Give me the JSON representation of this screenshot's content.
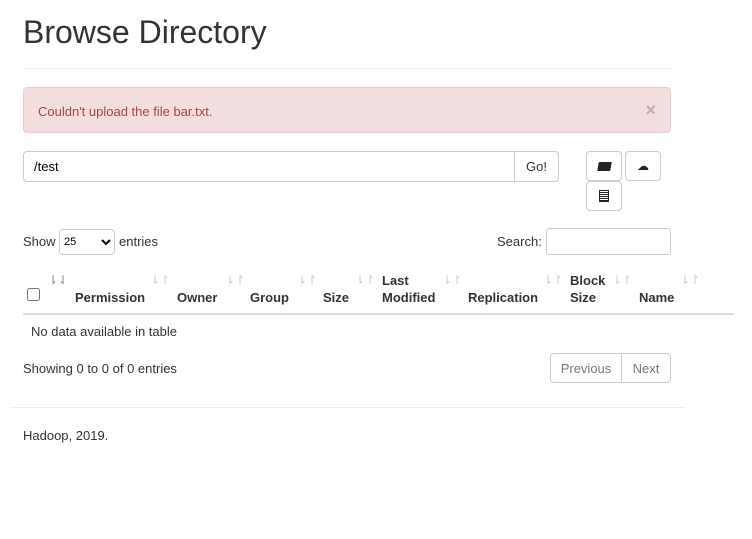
{
  "title": "Browse Directory",
  "alert": {
    "message": "Couldn't upload the file bar.txt.",
    "close": "×"
  },
  "path": {
    "value": "/test",
    "go": "Go!"
  },
  "icons": [
    "folder-open-icon",
    "cloud-upload-icon",
    "list-alt-icon"
  ],
  "length": {
    "show": "Show",
    "value": "25",
    "entries": "entries"
  },
  "search": {
    "label": "Search:",
    "value": ""
  },
  "columns": [
    {
      "l1": "",
      "l2": "Permission"
    },
    {
      "l1": "",
      "l2": "Owner"
    },
    {
      "l1": "",
      "l2": "Group"
    },
    {
      "l1": "",
      "l2": "Size"
    },
    {
      "l1": "Last",
      "l2": "Modified"
    },
    {
      "l1": "",
      "l2": "Replication"
    },
    {
      "l1": "Block",
      "l2": "Size"
    },
    {
      "l1": "",
      "l2": "Name"
    }
  ],
  "empty": "No data available in table",
  "info": "Showing 0 to 0 of 0 entries",
  "pager": {
    "prev": "Previous",
    "next": "Next"
  },
  "footer": "Hadoop, 2019."
}
